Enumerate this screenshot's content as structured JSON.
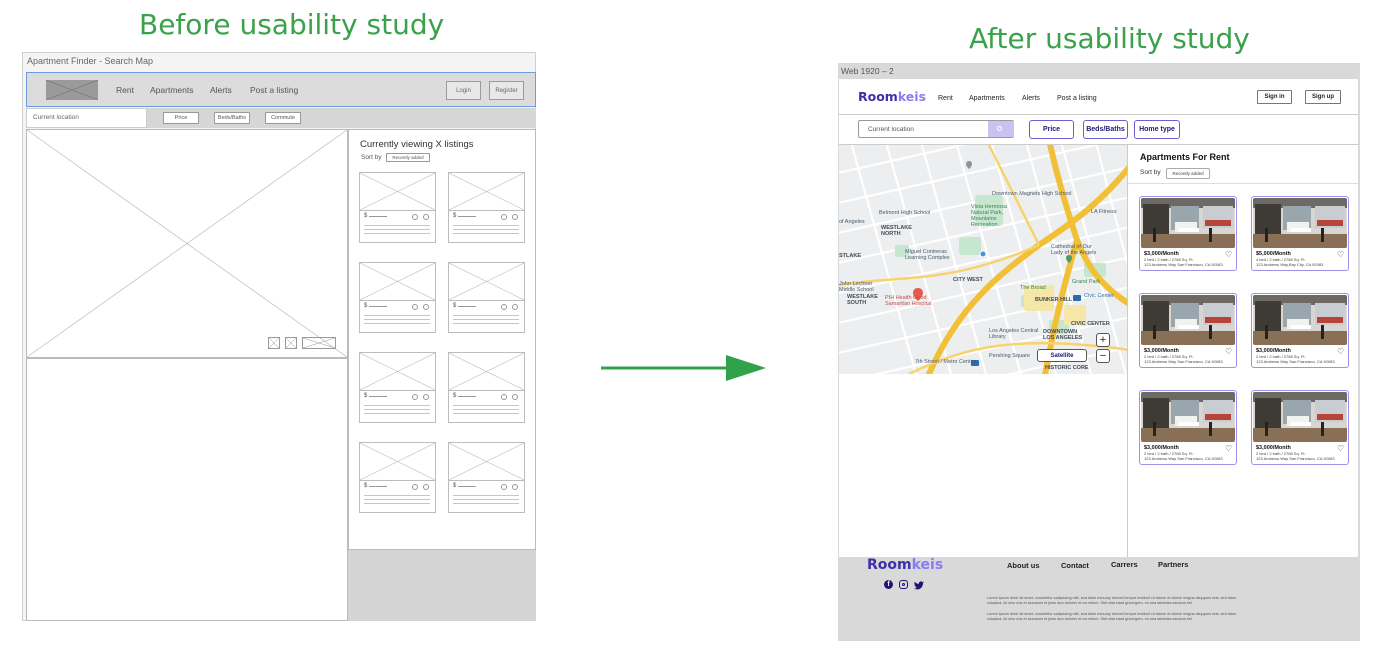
{
  "headings": {
    "before": "Before usability study",
    "after": "After usability study"
  },
  "wireframe": {
    "window_title": "Apartment Finder - Search Map",
    "nav": [
      "Rent",
      "Apartments",
      "Alerts",
      "Post a listing"
    ],
    "login": "Login",
    "register": "Register",
    "location_placeholder": "Current location",
    "filters": [
      "Price",
      "Beds/Baths",
      "Commute"
    ],
    "listing_title": "Currently viewing X listings",
    "sort_label": "Sort by",
    "sort_value": "Recently added",
    "price_symbol": "$"
  },
  "hifi": {
    "frame_title": "Web 1920 – 2",
    "logo_a": "Room",
    "logo_b": "keis",
    "nav": [
      "Rent",
      "Apartments",
      "Alerts",
      "Post a listing"
    ],
    "sign_in": "Sign in",
    "sign_up": "Sign up",
    "location_placeholder": "Current location",
    "filters": [
      "Price",
      "Beds/Baths",
      "Home type"
    ],
    "listings_title": "Apartments For Rent",
    "sort_label": "Sort by",
    "sort_value": "Recently added",
    "satellite": "Satellite",
    "zoom_in": "+",
    "zoom_out": "−",
    "map_labels": [
      "Downtown Magnets High School",
      "Vista Hermosa Natural Park, Mountains Recreation...",
      "Belmont High School",
      "WESTLAKE NORTH",
      "Miguel Contreras Learning Complex",
      "Cathedral of Our Lady of the Angels",
      "The Broad",
      "Grand Park",
      "CITY WEST",
      "BUNKER HILL",
      "Civic Center",
      "LA Fitness",
      "PIH Health Good Samaritan Hospital",
      "Los Angeles Central Library",
      "WESTLAKE SOUTH",
      "John Lechner Middle School",
      "CIVIC CENTER",
      "DOWNTOWN LOS ANGELES",
      "HISTORIC CORE",
      "7th Street / Metro Center",
      "Pershing Square",
      "of Angeles",
      "STLAKE"
    ],
    "listings": [
      {
        "price": "$3,000/Month",
        "beds": "2 bed / 2 bath / 2768 Sq. Ft.",
        "address": "123 Andrews Way San Francisco, CA 92083"
      },
      {
        "price": "$5,000/Month",
        "beds": "4 bed / 2 bath / 2768 Sq. Ft.",
        "address": "123 Andrews Way,Bay City, CA 92083"
      },
      {
        "price": "$3,000/Month",
        "beds": "2 bed / 2 bath / 2768 Sq. Ft.",
        "address": "123 Andrews Way San Francisco, CA 92083"
      },
      {
        "price": "$3,000/Month",
        "beds": "2 bed / 2 bath / 2768 Sq. Ft.",
        "address": "123 Andrews Way San Francisco, CA 92083"
      },
      {
        "price": "$3,000/Month",
        "beds": "2 bed / 2 bath / 2768 Sq. Ft.",
        "address": "123 Andrews Way San Francisco, CA 92083"
      },
      {
        "price": "$3,000/Month",
        "beds": "2 bed / 2 bath / 2768 Sq. Ft.",
        "address": "123 Andrews Way San Francisco, CA 92083"
      }
    ],
    "footer": {
      "logo_a": "Room",
      "logo_b": "keis",
      "links": [
        "About us",
        "Contact",
        "Carrers",
        "Partners"
      ],
      "social_icons": [
        "facebook-icon",
        "instagram-icon",
        "twitter-icon"
      ],
      "lorem1": "Lorem ipsum dolor sit amet, consetetur sadipscing elitr, sed diam nonumy eirmod tempor invidunt ut labore et dolore magna aliquyam erat, sed diam voluptua. At vero eos et accusam et justo duo dolores et ea rebum. Stet clita kasd gubergren, no sea takimata sanctus est",
      "lorem2": "Lorem ipsum dolor sit amet, consetetur sadipscing elitr, sed diam nonumy eirmod tempor invidunt ut labore et dolore magna aliquyam erat, sed diam voluptua. At vero eos et accusam et justo duo dolores et ea rebum. Stet clita kasd gubergren, no sea takimata sanctus est"
    }
  },
  "colors": {
    "heading": "#3aa24a",
    "arrow": "#31a14a",
    "brand_dark": "#3d2fa8",
    "brand_light": "#8a7cf2",
    "card_border": "#9b92ee"
  }
}
